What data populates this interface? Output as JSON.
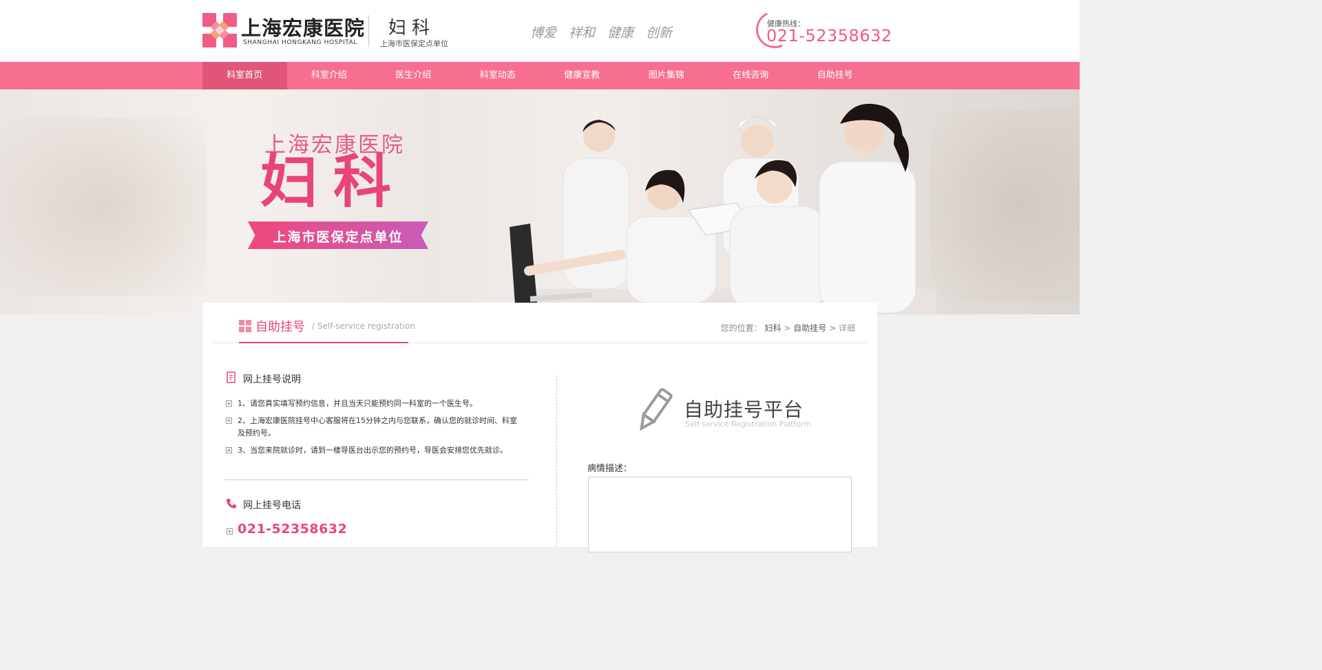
{
  "header": {
    "hospital_name": "上海宏康医院",
    "hospital_en": "SHANGHAI HONGKANG HOSPITAL",
    "department": "妇科",
    "department_sub": "上海市医保定点单位",
    "slogans": [
      "博爱",
      "祥和",
      "健康",
      "创新"
    ],
    "hotline_label": "健康热线：",
    "hotline_number": "021-52358632",
    "brand_color": "#f76f90",
    "accent_color": "#e8457c"
  },
  "nav": {
    "items": [
      {
        "label": "科室首页",
        "active": true
      },
      {
        "label": "科室介绍"
      },
      {
        "label": "医生介绍"
      },
      {
        "label": "科室动态"
      },
      {
        "label": "健康宣教"
      },
      {
        "label": "图片集锦"
      },
      {
        "label": "在线咨询"
      },
      {
        "label": "自助挂号"
      }
    ]
  },
  "banner": {
    "title": "上海宏康医院",
    "subtitle": "妇科",
    "ribbon": "上海市医保定点单位"
  },
  "section": {
    "title": "自助挂号",
    "title_en": "/ Self-service registration",
    "breadcrumb_prefix": "您的位置：",
    "breadcrumb": [
      "妇科",
      "自助挂号",
      "详细"
    ],
    "breadcrumb_sep": ">"
  },
  "info": {
    "title": "网上挂号说明",
    "items": [
      "1、请您真实填写预约信息，并且当天只能预约同一科室的一个医生号。",
      "2、上海宏康医院挂号中心客服将在15分钟之内与您联系，确认您的就诊时间、科室及预约号。",
      "3、当您来院就诊时，请到一楼导医台出示您的预约号，导医会安排您优先就诊。"
    ]
  },
  "phone": {
    "title": "网上挂号电话",
    "number": "021-52358632"
  },
  "platform": {
    "title": "自助挂号平台",
    "title_en": "Self-service Registration Platform",
    "desc_label": "病情描述："
  }
}
